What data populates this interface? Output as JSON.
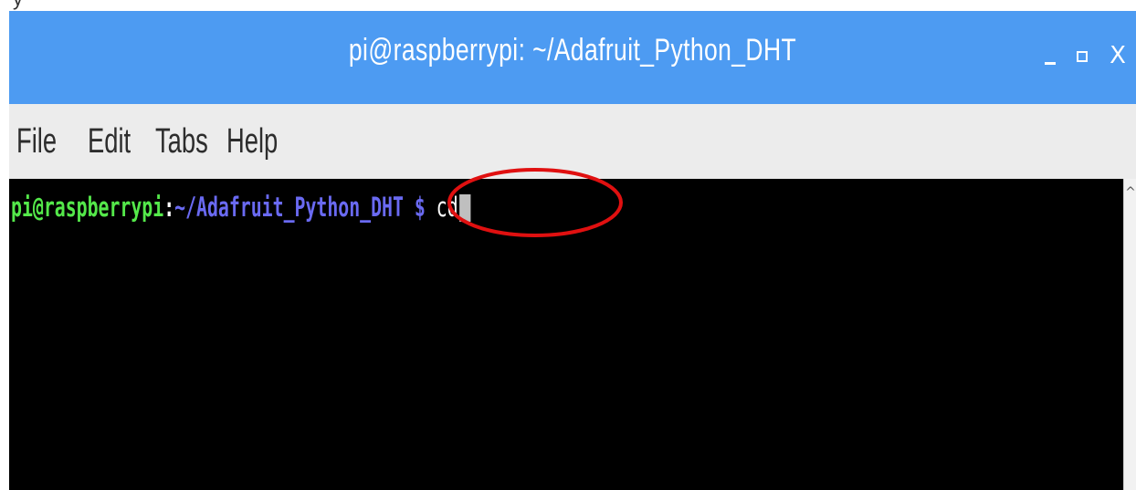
{
  "background_strip": {
    "text": "y                                                      "
  },
  "window": {
    "title": "pi@raspberrypi: ~/Adafruit_Python_DHT",
    "controls": {
      "minimize_label": "_",
      "maximize_label": "□",
      "close_label": "X"
    }
  },
  "menubar": {
    "items": [
      {
        "label": "File"
      },
      {
        "label": "Edit"
      },
      {
        "label": "Tabs"
      },
      {
        "label": "Help"
      }
    ]
  },
  "terminal": {
    "prompt_user": "pi@raspberrypi",
    "prompt_sep": ":",
    "prompt_path": "~/Adafruit_Python_DHT $",
    "command": " cd",
    "colors": {
      "background": "#000000",
      "user": "#54e84a",
      "path": "#6a6af2",
      "text": "#ffffff"
    }
  },
  "annotation": {
    "shape": "ellipse",
    "color": "#e01010"
  },
  "scrollbar": {
    "up_icon": "chevron-up-icon"
  }
}
